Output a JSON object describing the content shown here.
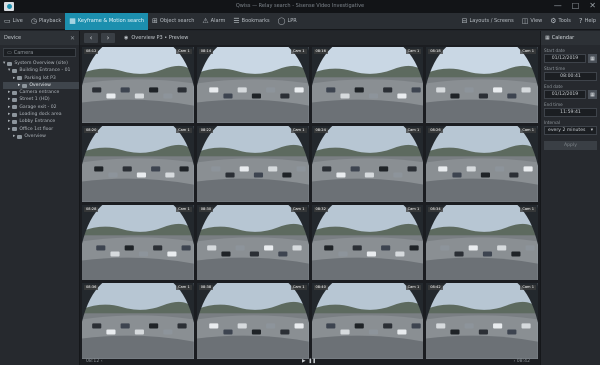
{
  "titlebar": {
    "title": "Qwiss — Relay search - Sisense Video Investigative",
    "win_buttons": [
      "—",
      "□",
      "✕"
    ]
  },
  "toolbar": {
    "items": [
      {
        "icon": "square-icon",
        "glyph": "▭",
        "label": "Live"
      },
      {
        "icon": "play-circle-icon",
        "glyph": "◷",
        "label": "Playback"
      },
      {
        "icon": "motion-search-icon",
        "glyph": "▦",
        "label": "Keyframe & Motion search",
        "active": true
      },
      {
        "icon": "object-icon",
        "glyph": "⊞",
        "label": "Object search"
      },
      {
        "icon": "alarm-icon",
        "glyph": "⚠",
        "label": "Alarm"
      },
      {
        "icon": "bookmark-icon",
        "glyph": "☰",
        "label": "Bookmarks"
      },
      {
        "icon": "lpr-icon",
        "glyph": "◯",
        "label": "LPR"
      }
    ],
    "right_items": [
      {
        "icon": "layout-icon",
        "glyph": "⊟",
        "label": "Layouts / Screens"
      },
      {
        "icon": "view-icon",
        "glyph": "◫",
        "label": "View"
      },
      {
        "icon": "tools-icon",
        "glyph": "⚙",
        "label": "Tools"
      },
      {
        "icon": "help-icon",
        "glyph": "?",
        "label": "Help"
      }
    ]
  },
  "sidebar": {
    "title": "Device",
    "close": "✕",
    "search_placeholder": "Camera",
    "tree": [
      {
        "indent": 0,
        "label": "System Overview (site)",
        "expanded": true
      },
      {
        "indent": 1,
        "label": "Building Entrance - 01",
        "expanded": true
      },
      {
        "indent": 2,
        "label": "Parking lot P3"
      },
      {
        "indent": 3,
        "label": "Overview",
        "selected": true
      },
      {
        "indent": 1,
        "label": "Camera entrance"
      },
      {
        "indent": 1,
        "label": "Street 1 (HD)"
      },
      {
        "indent": 1,
        "label": "Garage exit - 02"
      },
      {
        "indent": 1,
        "label": "Loading dock area"
      },
      {
        "indent": 1,
        "label": "Lobby Entrance"
      },
      {
        "indent": 1,
        "label": "Office 1st floor"
      },
      {
        "indent": 2,
        "label": "Overview"
      }
    ]
  },
  "main": {
    "back": "‹",
    "forward": "›",
    "path_icon": "camera-icon",
    "path": "Overview P3 • Preview"
  },
  "thumbnails": [
    {
      "time": "08:12",
      "cam": "Cam 1"
    },
    {
      "time": "08:14",
      "cam": "Cam 1"
    },
    {
      "time": "08:16",
      "cam": "Cam 1"
    },
    {
      "time": "08:18",
      "cam": "Cam 1"
    },
    {
      "time": "08:20",
      "cam": "Cam 1"
    },
    {
      "time": "08:22",
      "cam": "Cam 1"
    },
    {
      "time": "08:24",
      "cam": "Cam 1"
    },
    {
      "time": "08:26",
      "cam": "Cam 1"
    },
    {
      "time": "08:28",
      "cam": "Cam 1"
    },
    {
      "time": "08:30",
      "cam": "Cam 1"
    },
    {
      "time": "08:32",
      "cam": "Cam 1"
    },
    {
      "time": "08:34",
      "cam": "Cam 1"
    },
    {
      "time": "08:36",
      "cam": "Cam 1"
    },
    {
      "time": "08:38",
      "cam": "Cam 1"
    },
    {
      "time": "08:40",
      "cam": "Cam 1"
    },
    {
      "time": "08:42",
      "cam": "Cam 1"
    }
  ],
  "footer": {
    "left": "08:12 ‹",
    "play": "▶",
    "pause": "❚❚",
    "right": "› 08:42"
  },
  "rpanel": {
    "title": "Calendar",
    "start_label": "Start date",
    "start_date": "01/12/2019",
    "start_time_label": "Start time",
    "start_time": "08:00:41",
    "end_label": "End date",
    "end_date": "01/12/2019",
    "end_time_label": "End time",
    "end_time": "11:59:41",
    "interval_label": "Interval",
    "interval": "every 2 minutes",
    "apply": "Apply"
  }
}
